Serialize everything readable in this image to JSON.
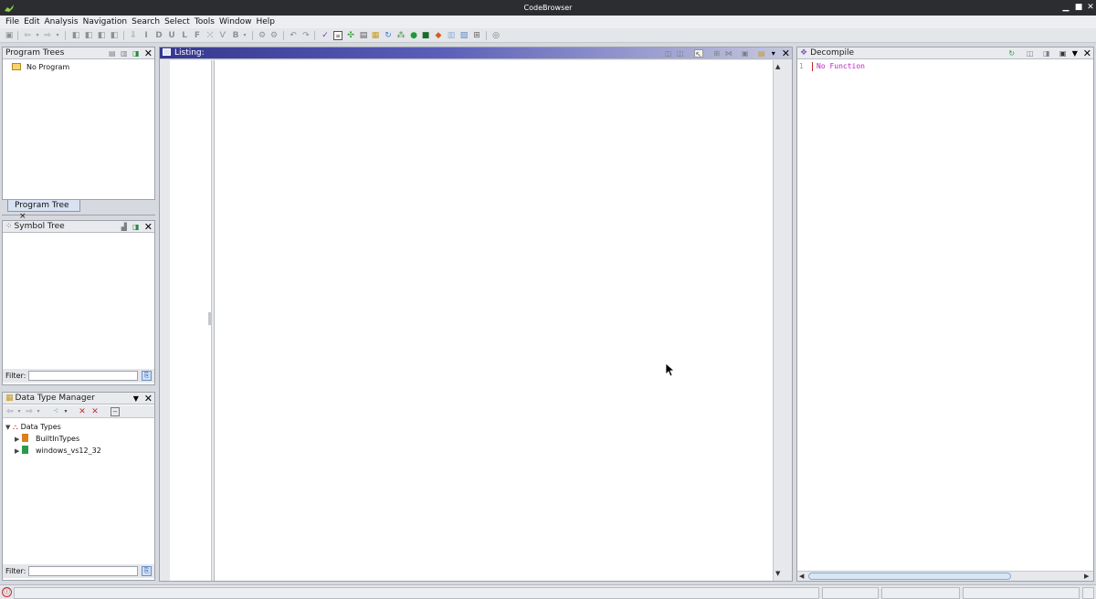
{
  "window": {
    "title": "CodeBrowser",
    "controls": [
      "minimize-icon",
      "maximize-icon",
      "close-icon"
    ]
  },
  "menu": [
    "File",
    "Edit",
    "Analysis",
    "Navigation",
    "Search",
    "Select",
    "Tools",
    "Window",
    "Help"
  ],
  "program_trees": {
    "title": "Program Trees",
    "items": [
      "No Program"
    ],
    "tab_label": "Program Tree",
    "tab_close": "×"
  },
  "symbol_tree": {
    "title": "Symbol Tree",
    "filter_label": "Filter:"
  },
  "data_type_manager": {
    "title": "Data Type Manager",
    "root": "Data Types",
    "children": [
      "BuiltInTypes",
      "windows_vs12_32"
    ],
    "filter_label": "Filter:"
  },
  "listing": {
    "title": "Listing:"
  },
  "decompile": {
    "title": "Decompile",
    "line_number": "1",
    "content": "No Function"
  },
  "colors": {
    "titlebar": "#2b2d31",
    "active_header_start": "#35378f",
    "decompile_text": "#c020c0"
  }
}
